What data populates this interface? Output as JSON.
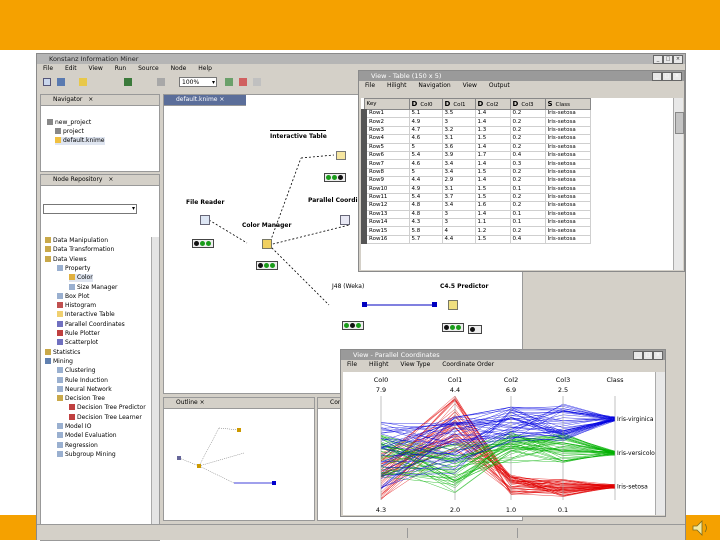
{
  "main_window": {
    "title": "Konstanz Information Miner",
    "menu": [
      "File",
      "Edit",
      "View",
      "Run",
      "Source",
      "Node",
      "Help"
    ],
    "zoom": "100%"
  },
  "navigator": {
    "tab": "Navigator",
    "items": [
      "new_project",
      "project",
      "default.knime"
    ]
  },
  "node_repository": {
    "tab": "Node Repository",
    "items": [
      "Data Manipulation",
      "Data Transformation",
      "Data Views",
      "Property",
      "Color",
      "Size Manager",
      "Box Plot",
      "Histogram",
      "Interactive Table",
      "Parallel Coordinates",
      "Rule Plotter",
      "Scatterplot",
      "Statistics",
      "Mining",
      "Clustering",
      "Rule Induction",
      "Neural Network",
      "Decision Tree",
      "Decision Tree Predictor",
      "Decision Tree Learner",
      "Model IO",
      "Model Evaluation",
      "Regression",
      "Subgroup Mining"
    ]
  },
  "workflow": {
    "tab": "default.knime",
    "nodes": {
      "interactive_table": "Interactive Table",
      "file_reader": "File Reader",
      "parallel_coords": "Parallel Coordinates",
      "color_manager": "Color Manager",
      "learner": "J48 (Weka)",
      "predictor": "C4.5 Predictor"
    }
  },
  "outline": {
    "tab": "Outline"
  },
  "console": {
    "tab": "Conso"
  },
  "table_view": {
    "title": "View - Table (150 x 5)",
    "menu": [
      "File",
      "Hilight",
      "Navigation",
      "View",
      "Output"
    ],
    "columns": [
      {
        "type": "",
        "name": "Key"
      },
      {
        "type": "D",
        "name": "Col0"
      },
      {
        "type": "D",
        "name": "Col1"
      },
      {
        "type": "D",
        "name": "Col2"
      },
      {
        "type": "D",
        "name": "Col3"
      },
      {
        "type": "S",
        "name": "Class"
      }
    ],
    "rows": [
      [
        "Row1",
        "5.1",
        "3.5",
        "1.4",
        "0.2",
        "Iris-setosa"
      ],
      [
        "Row2",
        "4.9",
        "3",
        "1.4",
        "0.2",
        "Iris-setosa"
      ],
      [
        "Row3",
        "4.7",
        "3.2",
        "1.3",
        "0.2",
        "Iris-setosa"
      ],
      [
        "Row4",
        "4.6",
        "3.1",
        "1.5",
        "0.2",
        "Iris-setosa"
      ],
      [
        "Row5",
        "5",
        "3.6",
        "1.4",
        "0.2",
        "Iris-setosa"
      ],
      [
        "Row6",
        "5.4",
        "3.9",
        "1.7",
        "0.4",
        "Iris-setosa"
      ],
      [
        "Row7",
        "4.6",
        "3.4",
        "1.4",
        "0.3",
        "Iris-setosa"
      ],
      [
        "Row8",
        "5",
        "3.4",
        "1.5",
        "0.2",
        "Iris-setosa"
      ],
      [
        "Row9",
        "4.4",
        "2.9",
        "1.4",
        "0.2",
        "Iris-setosa"
      ],
      [
        "Row10",
        "4.9",
        "3.1",
        "1.5",
        "0.1",
        "Iris-setosa"
      ],
      [
        "Row11",
        "5.4",
        "3.7",
        "1.5",
        "0.2",
        "Iris-setosa"
      ],
      [
        "Row12",
        "4.8",
        "3.4",
        "1.6",
        "0.2",
        "Iris-setosa"
      ],
      [
        "Row13",
        "4.8",
        "3",
        "1.4",
        "0.1",
        "Iris-setosa"
      ],
      [
        "Row14",
        "4.3",
        "3",
        "1.1",
        "0.1",
        "Iris-setosa"
      ],
      [
        "Row15",
        "5.8",
        "4",
        "1.2",
        "0.2",
        "Iris-setosa"
      ],
      [
        "Row16",
        "5.7",
        "4.4",
        "1.5",
        "0.4",
        "Iris-setosa"
      ]
    ]
  },
  "parallel_view": {
    "title": "View - Parallel Coordinates",
    "menu": [
      "File",
      "Hilight",
      "View Type",
      "Coordinate Order"
    ],
    "axes": [
      "Col0",
      "Col1",
      "Col2",
      "Col3",
      "Class"
    ],
    "top_values": [
      "7.9",
      "4.4",
      "6.9",
      "2.5"
    ],
    "bottom_values": [
      "4.3",
      "2.0",
      "1.0",
      "0.1"
    ],
    "classes": [
      "Iris-virginica",
      "Iris-versicolor",
      "Iris-setosa"
    ],
    "colors": {
      "setosa": "#e00000",
      "versicolor": "#00b000",
      "virginica": "#0000e0"
    }
  },
  "colors": {
    "accent": "#f5a100"
  }
}
